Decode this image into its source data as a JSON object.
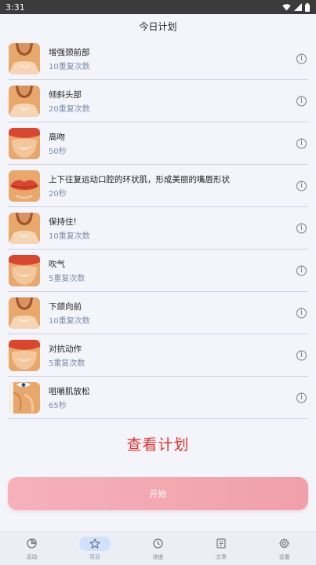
{
  "status_bar": {
    "time": "3:31"
  },
  "header": {
    "title": "今日计划"
  },
  "exercises": [
    {
      "name": "增强颈前部",
      "detail": "10重复次数",
      "thumb": "neck-icon"
    },
    {
      "name": "倾斜头部",
      "detail": "20重复次数",
      "thumb": "neck-icon"
    },
    {
      "name": "高吻",
      "detail": "50秒",
      "thumb": "lips-chin-icon"
    },
    {
      "name": "上下往复运动口腔的环状肌，形成美丽的嘴唇形状",
      "detail": "20秒",
      "thumb": "lips-icon"
    },
    {
      "name": "保持住!",
      "detail": "10重复次数",
      "thumb": "neck-icon"
    },
    {
      "name": "吹气",
      "detail": "5重复次数",
      "thumb": "lips-chin-icon"
    },
    {
      "name": "下颌向前",
      "detail": "10重复次数",
      "thumb": "neck-icon"
    },
    {
      "name": "对抗动作",
      "detail": "5重复次数",
      "thumb": "lips-chin-icon"
    },
    {
      "name": "咀嚼肌放松",
      "detail": "65秒",
      "thumb": "cheek-eye-icon"
    }
  ],
  "info_glyph": "i",
  "view_plan_label": "查看计划",
  "start_label": "开始",
  "nav": [
    {
      "label": "活动",
      "icon": "activity-icon",
      "active": false
    },
    {
      "label": "项目",
      "icon": "star-icon",
      "active": true
    },
    {
      "label": "进度",
      "icon": "clock-icon",
      "active": false
    },
    {
      "label": "文章",
      "icon": "article-icon",
      "active": false
    },
    {
      "label": "设置",
      "icon": "gear-icon",
      "active": false
    }
  ],
  "colors": {
    "accent_red": "#e3322f",
    "start_button": "#f0a0aa",
    "skin": "#e8a76b",
    "lips": "#d9452f",
    "active_nav": "#cfe1fb"
  }
}
